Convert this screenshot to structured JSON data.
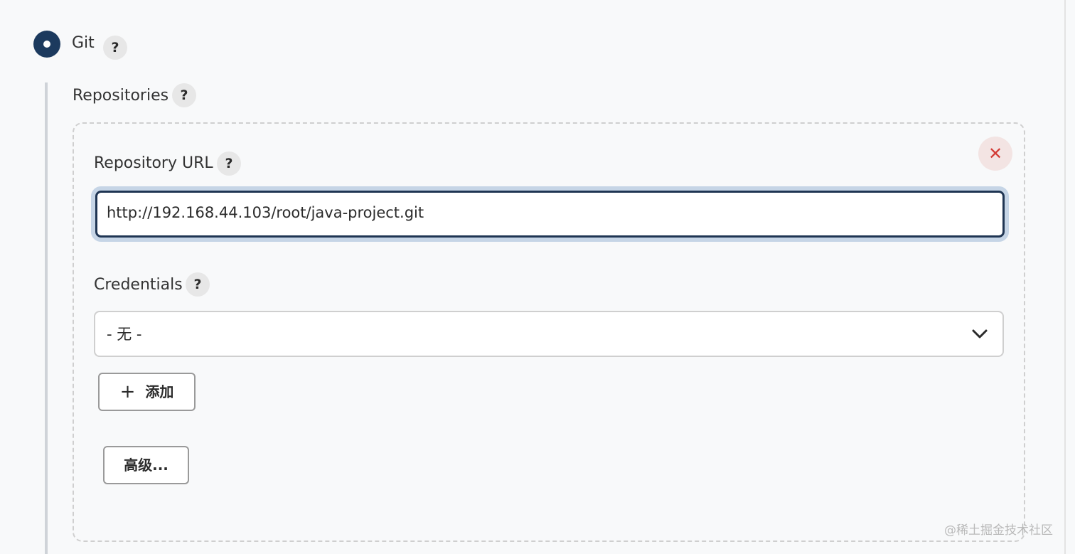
{
  "scm": {
    "option_label": "Git",
    "help_label": "?"
  },
  "repositories": {
    "label": "Repositories",
    "help_label": "?",
    "delete_label": "✕",
    "repository_url": {
      "label": "Repository URL",
      "help_label": "?",
      "value": "http://192.168.44.103/root/java-project.git"
    },
    "credentials": {
      "label": "Credentials",
      "help_label": "?",
      "selected": "- 无 -",
      "add_button_icon": "+",
      "add_button_label": "添加"
    },
    "advanced_button_label": "高级..."
  },
  "watermark": "@稀土掘金技术社区",
  "colors": {
    "accent": "#1c3a5e",
    "input_border_focus": "#1f3553",
    "focus_ring": "#c6d5e6",
    "delete_icon": "#d33b36",
    "delete_bg": "#f3e4e3"
  },
  "icons": {
    "radio": "radio-selected-icon",
    "help": "question-mark-icon",
    "delete": "close-icon",
    "dropdown": "chevron-down-icon",
    "add": "plus-icon"
  }
}
